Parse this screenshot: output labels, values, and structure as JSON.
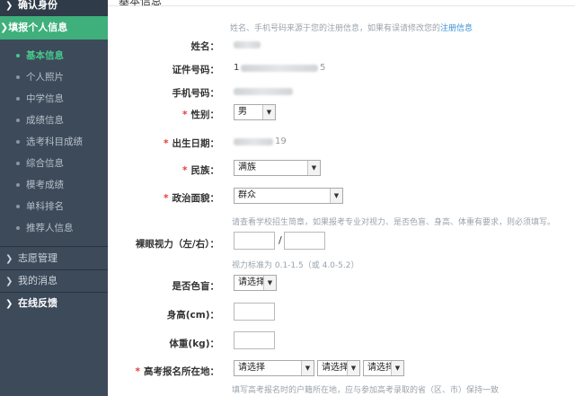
{
  "sidebar": {
    "confirm_identity": "确认身份",
    "fill_personal_info": "填报个人信息",
    "sub_items": [
      "基本信息",
      "个人照片",
      "中学信息",
      "成绩信息",
      "选考科目成绩",
      "综合信息",
      "模考成绩",
      "单科排名",
      "推荐人信息"
    ],
    "volunteer": "志愿管理",
    "my_messages": "我的消息",
    "feedback": "在线反馈"
  },
  "form": {
    "header_title": "基本信息",
    "notice": "姓名、手机号码来源于您的注册信息，如果有误请修改您的",
    "notice_link": "注册信息",
    "name_label": "姓名：",
    "id_label": "证件号码：",
    "id_partial": "1",
    "id_tail": "5",
    "phone_label": "手机号码：",
    "gender_label": "性别：",
    "gender_value": "男",
    "birth_label": "出生日期：",
    "birth_tail": "19",
    "ethnicity_label": "民族：",
    "ethnicity_value": "满族",
    "politics_label": "政治面貌：",
    "politics_value": "群众",
    "vision_note": "请查看学校招生简章，如果报考专业对视力、是否色盲、身高、体重有要求，则必须填写。",
    "vision_label": "裸眼视力（左/右）：",
    "vision_sep": "/",
    "vision_hint": "视力标准为 0.1-1.5（或 4.0-5.2）",
    "colorblind_label": "是否色盲：",
    "colorblind_value": "请选择",
    "height_label": "身高(cm)：",
    "weight_label": "体重(kg)：",
    "exam_location_label": "高考报名所在地：",
    "exam_select_1": "请选择",
    "exam_select_2": "请选择",
    "exam_select_3": "请选择",
    "exam_note": "填写高考报名时的户籍所在地，应与参加高考录取的省（区、市）保持一致"
  },
  "colors": {
    "sidebar_bg": "#3c4a5a",
    "sidebar_active": "#3faf7c",
    "current_sub": "#47c98c",
    "required_star": "#e63b3b",
    "link": "#3a8fd6"
  }
}
